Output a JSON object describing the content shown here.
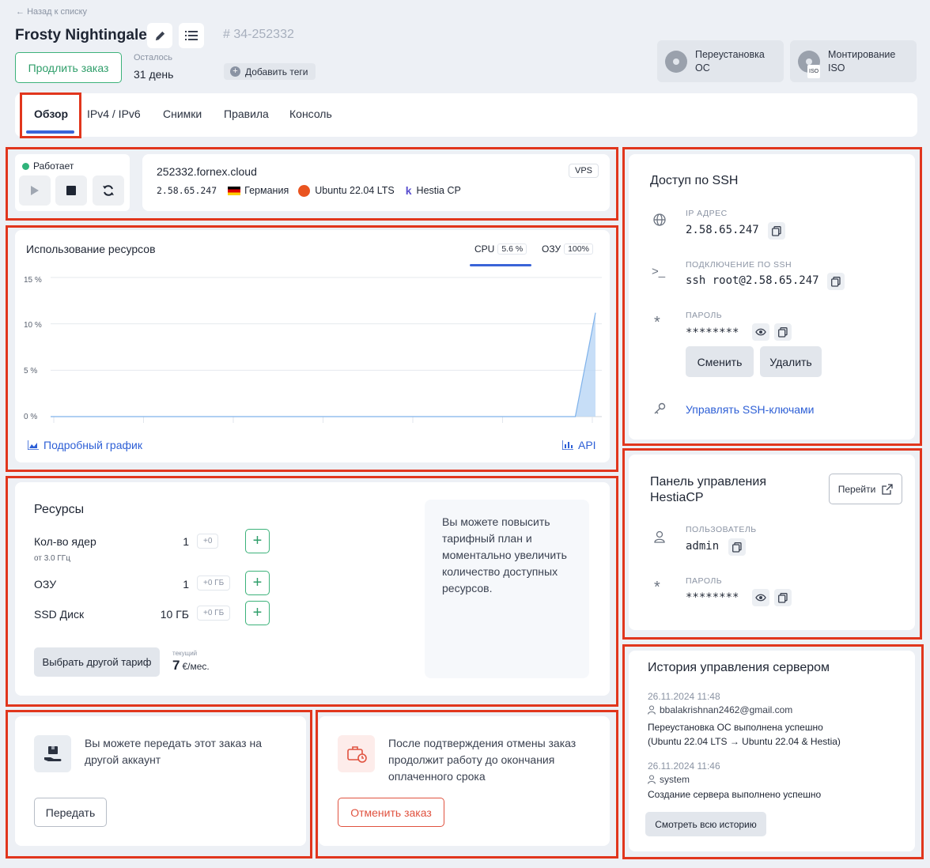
{
  "header": {
    "back_label": "Назад к списку",
    "server_name": "Frosty Nightingale",
    "order_number": "# 34-252332",
    "extend_label": "Продлить заказ",
    "remaining_label": "Осталось",
    "remaining_value": "31 день",
    "add_tags_label": "Добавить теги",
    "reinstall_label_1": "Переустановка",
    "reinstall_label_2": "ОС",
    "mount_label_1": "Монтирование",
    "mount_label_2": "ISO",
    "mount_badge": "ISO"
  },
  "tabs": [
    {
      "label": "Обзор"
    },
    {
      "label": "IPv4 / IPv6"
    },
    {
      "label": "Снимки"
    },
    {
      "label": "Правила"
    },
    {
      "label": "Консоль"
    }
  ],
  "status": {
    "label": "Работает",
    "color": "#2fb37a"
  },
  "server": {
    "hostname": "252332.fornex.cloud",
    "type_badge": "VPS",
    "ip": "2.58.65.247",
    "country": "Германия",
    "os": "Ubuntu 22.04 LTS",
    "panel": "Hestia CP"
  },
  "usage": {
    "title": "Использование ресурсов",
    "cpu_label": "CPU",
    "cpu_value": "5.6 %",
    "ram_label": "ОЗУ",
    "ram_value": "100%",
    "detail_link": "Подробный график",
    "api_link": "API"
  },
  "chart_data": {
    "type": "area",
    "title": "Использование ресурсов",
    "series": [
      {
        "name": "CPU",
        "values": [
          0,
          0,
          0,
          0,
          0,
          0,
          0,
          0,
          0,
          0,
          0,
          0,
          0,
          0,
          0,
          0,
          0,
          0,
          0,
          0,
          0,
          0,
          0,
          0,
          0,
          0,
          0,
          11.2
        ]
      }
    ],
    "y_ticks": [
      "15 %",
      "10 %",
      "5 %",
      "0 %"
    ],
    "ylim": [
      0,
      15
    ],
    "grid": true,
    "accent": "#b9d6f5"
  },
  "resources": {
    "title": "Ресурсы",
    "cores_label": "Кол-во ядер",
    "cores_sub": "от 3.0 ГГц",
    "cores_value": "1",
    "cores_add": "+0",
    "ram_label": "ОЗУ",
    "ram_value": "1",
    "ram_add": "+0 ГБ",
    "ssd_label": "SSD Диск",
    "ssd_value": "10 ГБ",
    "ssd_add": "+0 ГБ",
    "choose_plan": "Выбрать другой тариф",
    "price_label": "текущий",
    "price_value": "7",
    "price_unit": "€/мес.",
    "upgrade_text": "Вы можете повысить тарифный план и моментально увеличить количество доступных ресурсов."
  },
  "transfer": {
    "text": "Вы можете передать этот заказ на другой аккаунт",
    "button": "Передать"
  },
  "cancel": {
    "text": "После подтверждения отмены заказ продолжит работу до окончания оплаченного срока",
    "button": "Отменить заказ"
  },
  "ssh": {
    "title": "Доступ по SSH",
    "ip_label": "IP АДРЕС",
    "ip_value": "2.58.65.247",
    "conn_label": "ПОДКЛЮЧЕНИЕ ПО SSH",
    "conn_value": "ssh root@2.58.65.247",
    "pass_label": "ПАРОЛЬ",
    "pass_value": "********",
    "change_btn": "Сменить",
    "delete_btn": "Удалить",
    "keys_link": "Управлять SSH-ключами"
  },
  "panel": {
    "title": "Панель управления HestiaCP",
    "go_btn": "Перейти",
    "user_label": "ПОЛЬЗОВАТЕЛЬ",
    "user_value": "admin",
    "pass_label": "ПАРОЛЬ",
    "pass_value": "********"
  },
  "history": {
    "title": "История управления сервером",
    "entries": [
      {
        "date": "26.11.2024 11:48",
        "user": "bbalakrishnan2462@gmail.com",
        "text1": "Переустановка ОС выполнена успешно",
        "text2": "(Ubuntu 22.04 LTS → Ubuntu 22.04 & Hestia)"
      },
      {
        "date": "26.11.2024 11:46",
        "user": "system",
        "text1": "Создание сервера выполнено успешно",
        "text2": ""
      }
    ],
    "all_btn": "Смотреть всю историю"
  }
}
